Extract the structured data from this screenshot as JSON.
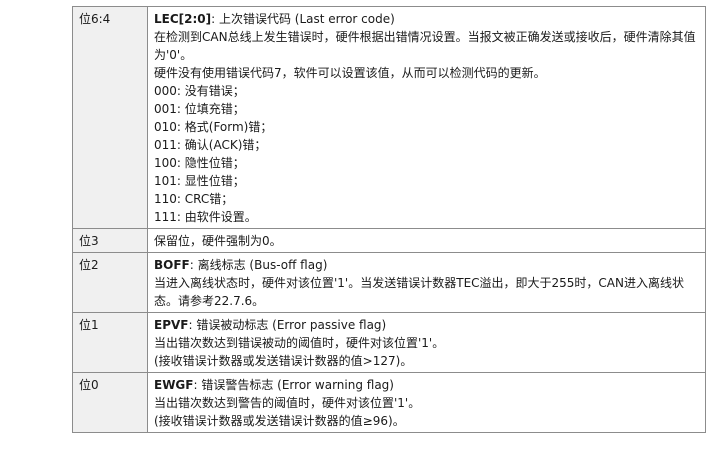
{
  "rows": [
    {
      "bits": "位6:4",
      "name": "LEC[2:0]",
      "title": ": 上次错误代码 (Last error code)",
      "lines": [
        "在检测到CAN总线上发生错误时，硬件根据出错情况设置。当报文被正确发送或接收后，硬件清除其值为'0'。",
        "硬件没有使用错误代码7，软件可以设置该值，从而可以检测代码的更新。",
        "000: 没有错误；",
        "001: 位填充错；",
        "010: 格式(Form)错；",
        "011: 确认(ACK)错；",
        "100: 隐性位错；",
        "101: 显性位错；",
        "110: CRC错；",
        "111: 由软件设置。"
      ]
    },
    {
      "bits": "位3",
      "lines": [
        "保留位，硬件强制为0。"
      ]
    },
    {
      "bits": "位2",
      "name": "BOFF",
      "title": ": 离线标志 (Bus-off flag)",
      "lines": [
        "当进入离线状态时，硬件对该位置'1'。当发送错误计数器TEC溢出，即大于255时，CAN进入离线状态。请参考22.7.6。"
      ]
    },
    {
      "bits": "位1",
      "name": "EPVF",
      "title": ": 错误被动标志 (Error passive flag)",
      "lines": [
        "当出错次数达到错误被动的阈值时，硬件对该位置'1'。",
        "(接收错误计数器或发送错误计数器的值>127)。"
      ]
    },
    {
      "bits": "位0",
      "name": "EWGF",
      "title": ": 错误警告标志 (Error warning flag)",
      "lines": [
        "当出错次数达到警告的阈值时，硬件对该位置'1'。",
        "(接收错误计数器或发送错误计数器的值≥96)。"
      ]
    }
  ]
}
